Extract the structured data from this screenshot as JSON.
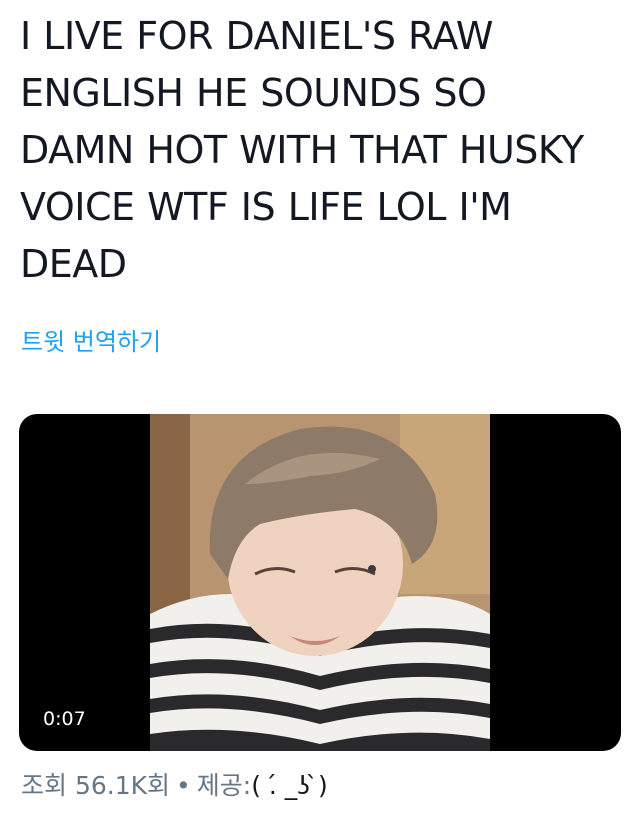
{
  "tweet": {
    "text": "I LIVE FOR DANIEL'S RAW\nENGLISH HE SOUNDS SO\nDAMN HOT WITH THAT HUSKY\nVOICE WTF IS LIFE LOL I'M\nDEAD",
    "translate_label": "트윗 번역하기"
  },
  "video": {
    "duration": "0:07"
  },
  "meta": {
    "views_label": "조회 56.1K회",
    "separator": "•",
    "provider_label": "제공:",
    "provider_name": "( .́ _ʖ ̀)"
  },
  "colors": {
    "text": "#141823",
    "link": "#1da1f2",
    "meta": "#657786",
    "video_bg": "#000000"
  }
}
